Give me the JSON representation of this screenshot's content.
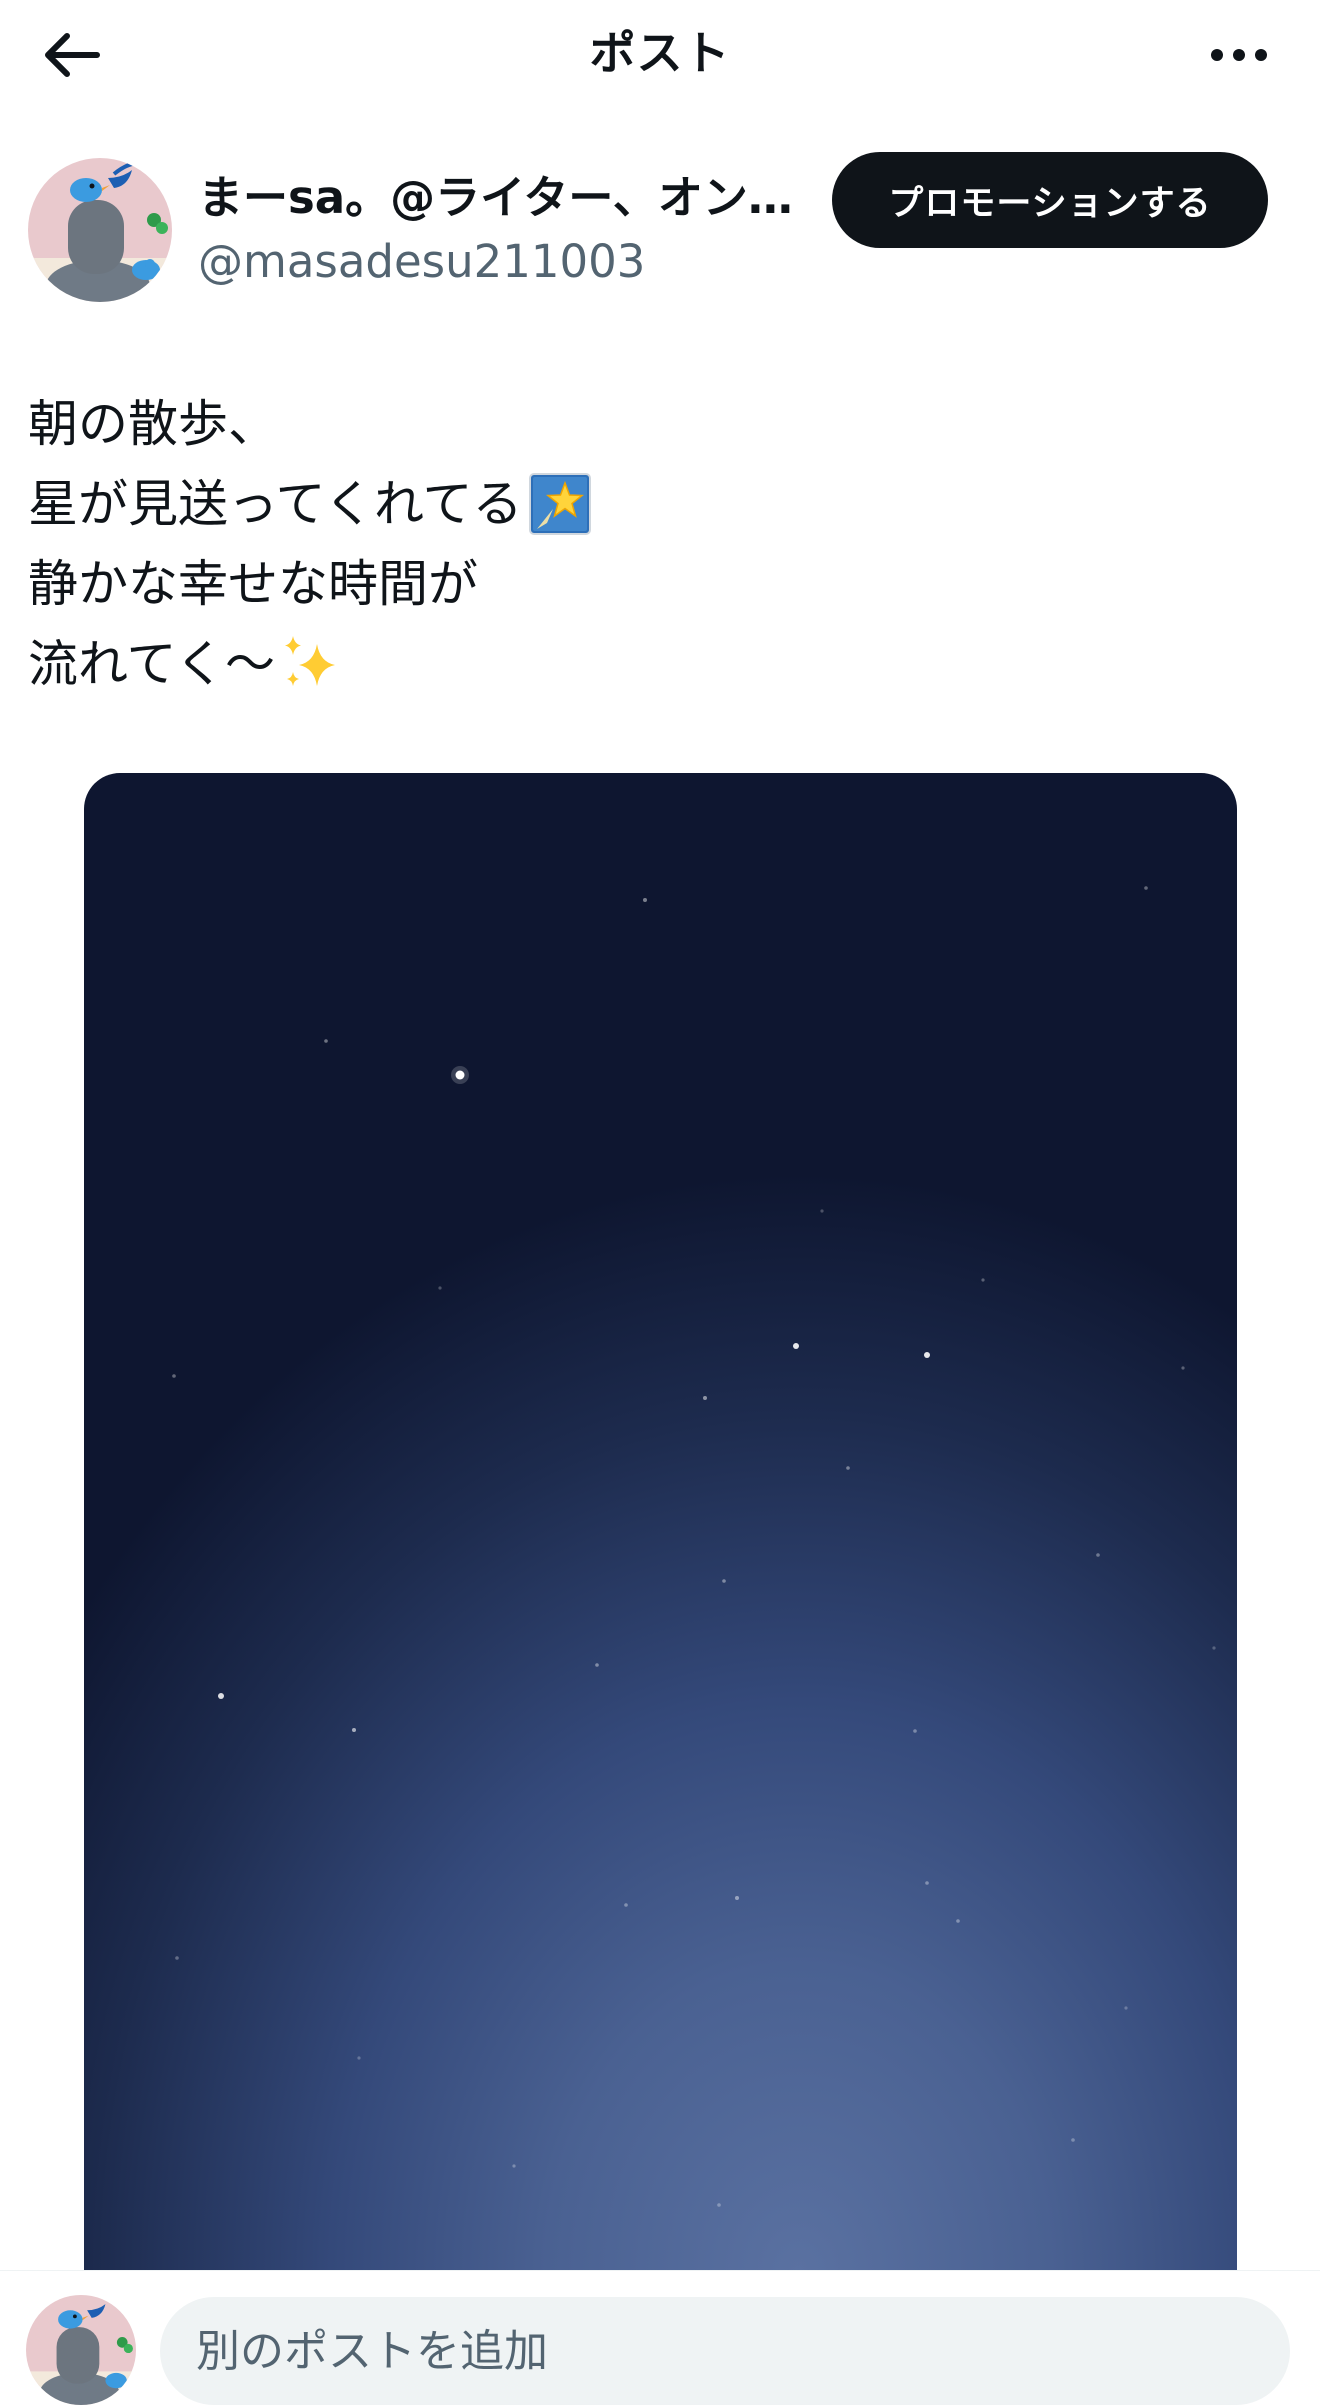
{
  "header": {
    "title": "ポスト",
    "back_icon": "arrow-left-icon",
    "more_icon": "more-horizontal-icon"
  },
  "author": {
    "display_name": "まーsa。@ライター、オン…",
    "handle": "@masadesu211003",
    "avatar": "bird-avatar",
    "promote_label": "プロモーションする"
  },
  "post": {
    "lines": [
      "朝の散歩、",
      "星が見送ってくれてる",
      "静かな幸せな時間が",
      "流れてく〜"
    ],
    "emoji": {
      "line2": "glowing-star-emoji",
      "line4": "sparkles-emoji"
    }
  },
  "media": {
    "subject": "night-sky-photo"
  },
  "reply": {
    "placeholder": "別のポストを追加"
  },
  "colors": {
    "text": "#0f1419",
    "secondary": "#536471",
    "button_bg": "#0f1419",
    "input_bg": "#eff3f4"
  }
}
